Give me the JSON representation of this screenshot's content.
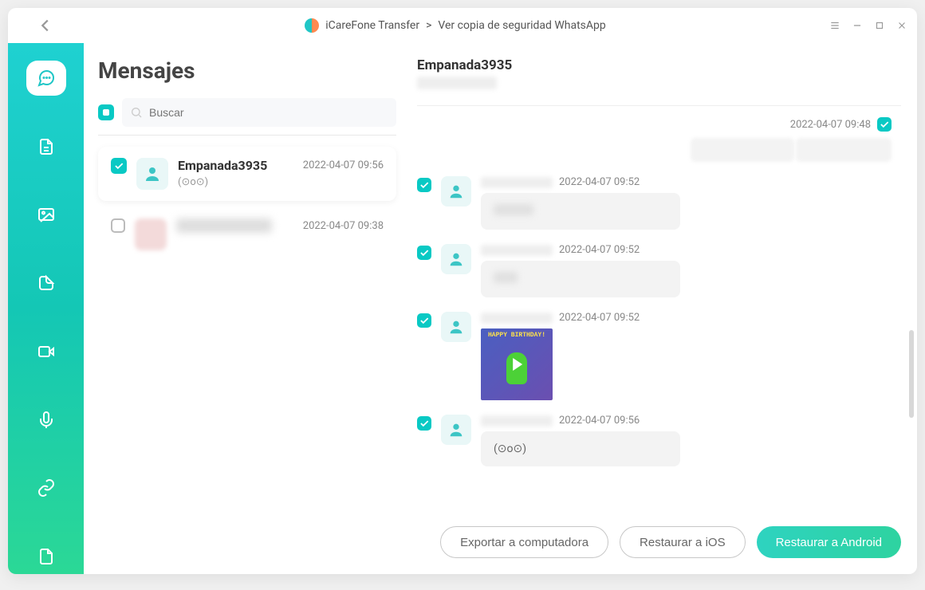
{
  "titlebar": {
    "app_name": "iCareFone Transfer",
    "breadcrumb_sep": ">",
    "page_name": "Ver copia de seguridad WhatsApp"
  },
  "middle": {
    "heading": "Mensajes",
    "search_placeholder": "Buscar",
    "conversations": [
      {
        "name": "Empanada3935",
        "time": "2022-04-07 09:56",
        "preview": "(⊙o⊙)",
        "selected": true,
        "checked": true,
        "blurred": false
      },
      {
        "name": "———",
        "time": "2022-04-07 09:38",
        "preview": "",
        "selected": false,
        "checked": false,
        "blurred": true
      }
    ]
  },
  "chat": {
    "contact_name": "Empanada3935",
    "top_date": "2022-04-07 09:48",
    "messages": [
      {
        "direction": "out",
        "time": "2022-04-07 09:48"
      },
      {
        "direction": "in",
        "time": "2022-04-07 09:52",
        "type": "text-blur"
      },
      {
        "direction": "in",
        "time": "2022-04-07 09:52",
        "type": "text-blur"
      },
      {
        "direction": "in",
        "time": "2022-04-07 09:52",
        "type": "video",
        "video_caption": "HAPPY BIRTHDAY!"
      },
      {
        "direction": "in",
        "time": "2022-04-07 09:56",
        "type": "text",
        "text": "(⊙o⊙)"
      }
    ]
  },
  "footer": {
    "export_label": "Exportar a computadora",
    "restore_ios_label": "Restaurar a iOS",
    "restore_android_label": "Restaurar a Android"
  }
}
